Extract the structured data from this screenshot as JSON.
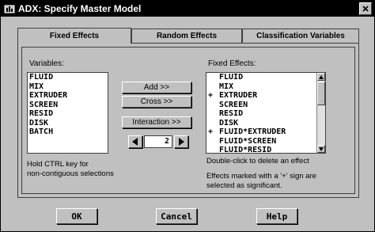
{
  "window": {
    "title": "ADX: Specify Master Model"
  },
  "tabs": [
    {
      "label": "Fixed Effects",
      "active": true
    },
    {
      "label": "Random Effects",
      "active": false
    },
    {
      "label": "Classification Variables",
      "active": false
    }
  ],
  "variables": {
    "label": "Variables:",
    "items": [
      "FLUID",
      "MIX",
      "EXTRUDER",
      "SCREEN",
      "RESID",
      "DISK",
      "BATCH"
    ],
    "hint_line1": "Hold CTRL key for",
    "hint_line2": "non-contiguous selections"
  },
  "actions": {
    "add_label": "Add >>",
    "cross_label": "Cross >>",
    "interaction_label": "Interaction >>",
    "interaction_order": "2"
  },
  "fixed_effects": {
    "label": "Fixed Effects:",
    "items": [
      {
        "mark": "",
        "name": "FLUID"
      },
      {
        "mark": "",
        "name": "MIX"
      },
      {
        "mark": "+",
        "name": "EXTRUDER"
      },
      {
        "mark": "",
        "name": "SCREEN"
      },
      {
        "mark": "",
        "name": "RESID"
      },
      {
        "mark": "",
        "name": "DISK"
      },
      {
        "mark": "+",
        "name": "FLUID*EXTRUDER"
      },
      {
        "mark": "",
        "name": "FLUID*SCREEN"
      },
      {
        "mark": "",
        "name": "FLUID*RESID"
      }
    ],
    "hint_delete": "Double-click to delete an effect",
    "hint_sig_line1": "Effects marked with a '+' sign are",
    "hint_sig_line2": "selected as significant."
  },
  "footer": {
    "ok_label": "OK",
    "cancel_label": "Cancel",
    "help_label": "Help"
  }
}
